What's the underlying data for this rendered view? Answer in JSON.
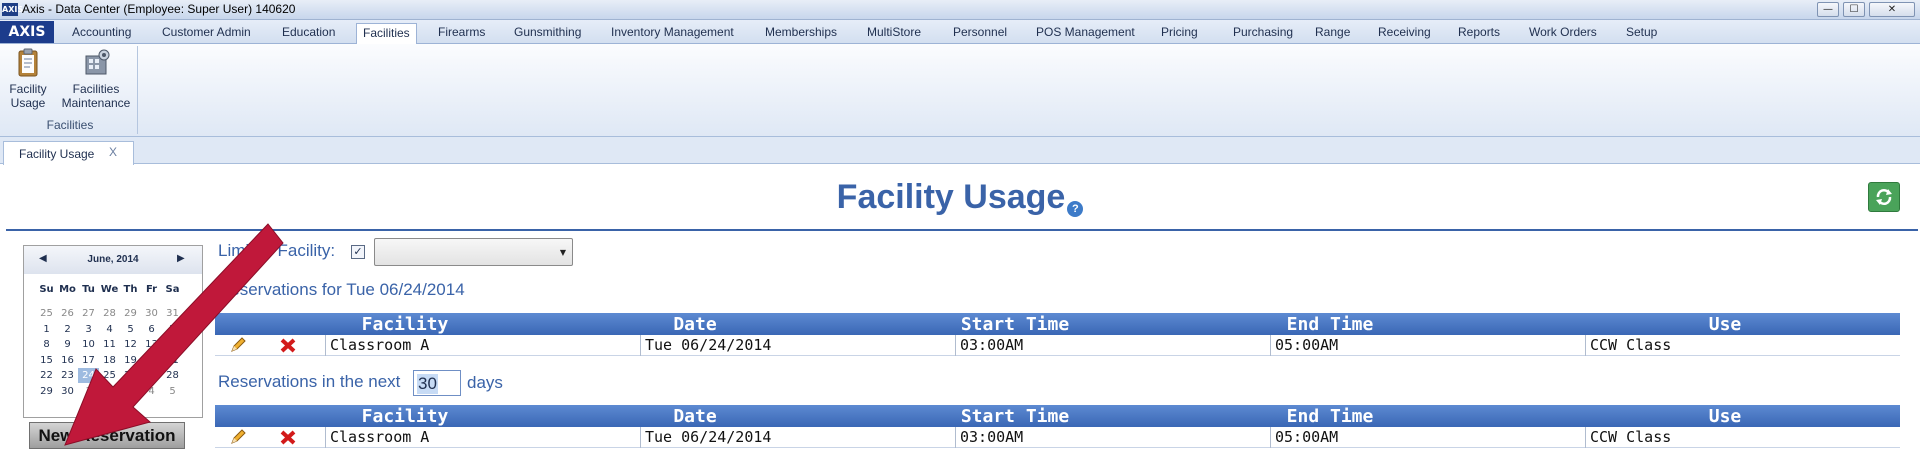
{
  "window": {
    "app_icon": "AXIS",
    "title": "Axis - Data Center  (Employee: Super User) 140620",
    "minimize": "—",
    "maximize": "☐",
    "close": "✕"
  },
  "menu": {
    "logo": "AXIS",
    "tabs": [
      {
        "label": "Accounting"
      },
      {
        "label": "Customer Admin"
      },
      {
        "label": "Education"
      },
      {
        "label": "Facilities"
      },
      {
        "label": "Firearms"
      },
      {
        "label": "Gunsmithing"
      },
      {
        "label": "Inventory Management"
      },
      {
        "label": "Memberships"
      },
      {
        "label": "MultiStore"
      },
      {
        "label": "Personnel"
      },
      {
        "label": "POS Management"
      },
      {
        "label": "Pricing"
      },
      {
        "label": "Purchasing"
      },
      {
        "label": "Range"
      },
      {
        "label": "Receiving"
      },
      {
        "label": "Reports"
      },
      {
        "label": "Work Orders"
      },
      {
        "label": "Setup"
      }
    ],
    "active_tab": "Facilities"
  },
  "ribbon": {
    "group_label": "Facilities",
    "buttons": [
      {
        "line1": "Facility",
        "line2": "Usage",
        "icon": "clipboard-icon"
      },
      {
        "line1": "Facilities",
        "line2": "Maintenance",
        "icon": "gears-icon"
      }
    ]
  },
  "doc_tab": {
    "label": "Facility Usage",
    "close": "X"
  },
  "page": {
    "title": "Facility Usage",
    "help": "?",
    "refresh_icon": "refresh-icon"
  },
  "filter": {
    "limit_label": "Limit to Facility:",
    "limit_checked": "✓",
    "selected_facility": ""
  },
  "calendar": {
    "month": "June, 2014",
    "prev": "◀",
    "next": "▶",
    "dow": [
      "Su",
      "Mo",
      "Tu",
      "We",
      "Th",
      "Fr",
      "Sa"
    ],
    "weeks": [
      [
        "25",
        "26",
        "27",
        "28",
        "29",
        "30",
        "31"
      ],
      [
        "1",
        "2",
        "3",
        "4",
        "5",
        "6",
        "7"
      ],
      [
        "8",
        "9",
        "10",
        "11",
        "12",
        "13",
        "14"
      ],
      [
        "15",
        "16",
        "17",
        "18",
        "19",
        "20",
        "21"
      ],
      [
        "22",
        "23",
        "24",
        "25",
        "26",
        "27",
        "28"
      ],
      [
        "29",
        "30",
        "1",
        "2",
        "3",
        "4",
        "5"
      ]
    ],
    "selected": "24"
  },
  "new_reservation_label": "New Reservation",
  "today_section": {
    "label": "Reservations for Tue 06/24/2014",
    "columns": [
      "Facility",
      "Date",
      "Start Time",
      "End Time",
      "Use"
    ],
    "rows": [
      {
        "facility": "Classroom A",
        "date": "Tue 06/24/2014",
        "start": "03:00AM",
        "end": "05:00AM",
        "use": "CCW Class"
      }
    ]
  },
  "upcoming_section": {
    "label_prefix": "Reservations in the next",
    "days": "30",
    "label_suffix": "days",
    "columns": [
      "Facility",
      "Date",
      "Start Time",
      "End Time",
      "Use"
    ],
    "rows": [
      {
        "facility": "Classroom A",
        "date": "Tue 06/24/2014",
        "start": "03:00AM",
        "end": "05:00AM",
        "use": "CCW Class"
      }
    ]
  },
  "colors": {
    "accent": "#3a63a8",
    "header_blue": "#3a67b5",
    "annotation_arrow": "#c0183a",
    "refresh_green": "#4aa35a"
  }
}
